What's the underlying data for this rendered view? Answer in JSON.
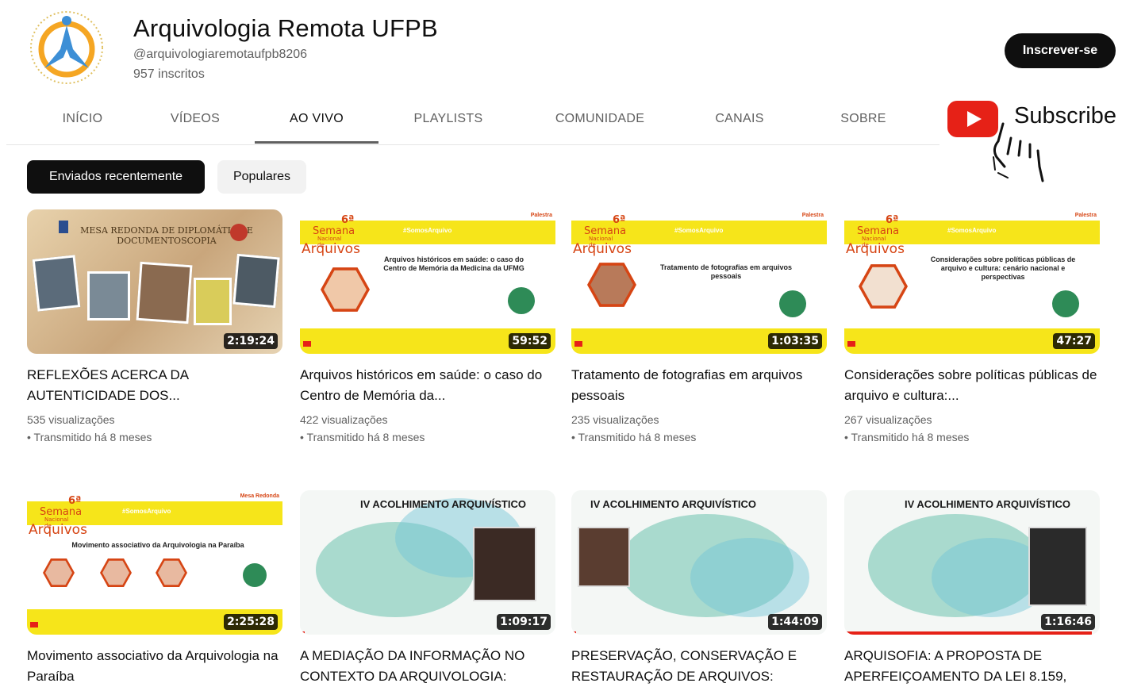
{
  "channel": {
    "title": "Arquivologia Remota UFPB",
    "handle": "@arquivologiaremotaufpb8206",
    "subscribers": "957 inscritos",
    "subscribe_label": "Inscrever-se"
  },
  "tabs": [
    "INÍCIO",
    "VÍDEOS",
    "AO VIVO",
    "PLAYLISTS",
    "COMUNIDADE",
    "CANAIS",
    "SOBRE"
  ],
  "active_tab": "AO VIVO",
  "overlay": {
    "subscribe_text": "Subscribe"
  },
  "chips": {
    "recent": "Enviados recentemente",
    "popular": "Populares"
  },
  "videos": [
    {
      "title": "REFLEXÕES ACERCA DA AUTENTICIDADE DOS...",
      "views": "535 visualizações",
      "when": "• Transmitido há 8 meses",
      "duration": "2:19:24"
    },
    {
      "title": "Arquivos históricos em saúde: o caso do Centro de Memória da...",
      "views": "422 visualizações",
      "when": "• Transmitido há 8 meses",
      "duration": "59:52"
    },
    {
      "title": "Tratamento de fotografias em arquivos pessoais",
      "views": "235 visualizações",
      "when": "• Transmitido há 8 meses",
      "duration": "1:03:35"
    },
    {
      "title": "Considerações sobre políticas públicas de arquivo e cultura:...",
      "views": "267 visualizações",
      "when": "• Transmitido há 8 meses",
      "duration": "47:27"
    },
    {
      "title": "Movimento associativo da Arquivologia na Paraíba",
      "duration": "2:25:28"
    },
    {
      "title": "A MEDIAÇÃO DA INFORMAÇÃO NO CONTEXTO DA ARQUIVOLOGIA:",
      "duration": "1:09:17",
      "progress": 0.02
    },
    {
      "title": "PRESERVAÇÃO, CONSERVAÇÃO E RESTAURAÇÃO DE ARQUIVOS:",
      "duration": "1:44:09",
      "progress": 0.02
    },
    {
      "title": "ARQUISOFIA: A PROPOSTA DE APERFEIÇOAMENTO DA LEI 8.159,",
      "duration": "1:16:46",
      "progress": 0.97
    }
  ],
  "thumbs": {
    "semana_number": "6ª",
    "semana_word": "Semana",
    "semana_nac": "Nacional de",
    "semana_arq": "Arquivos",
    "hashtag": "#SomosArquivo",
    "palestra": "Palestra",
    "mesa_redonda": "Mesa Redonda",
    "t1_text": "MESA REDONDA DE DIPLOMÁTICA E DOCUMENTOSCOPIA",
    "t2_text": "Arquivos históricos em saúde: o caso do Centro de Memória da Medicina da UFMG",
    "t3_text": "Tratamento de fotografias em arquivos pessoais",
    "t4_text": "Considerações sobre políticas públicas de arquivo e cultura: cenário nacional e perspectivas",
    "t5_text": "Movimento associativo da Arquivologia na Paraíba",
    "iv_title": "IV ACOLHIMENTO ARQUIVÍSTICO"
  },
  "colors": {
    "accent_red": "#e62117",
    "semana_orange": "#d64514",
    "semana_yellow": "#f6e51a"
  }
}
